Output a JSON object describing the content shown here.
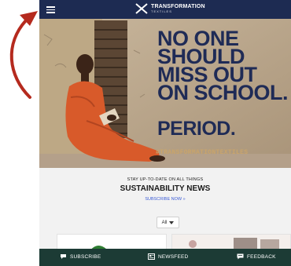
{
  "header": {
    "logo_title": "TRANSFORMATION",
    "logo_subtitle": "TEXTILES"
  },
  "hero": {
    "headline_lines": [
      "NO ONE",
      "SHOULD",
      "MISS OUT",
      "ON SCHOOL."
    ],
    "period": "PERIOD.",
    "hashtag": "#TRANSFORMATIONTEXTILES"
  },
  "news": {
    "kicker": "STAY UP-TO-DATE ON ALL THINGS",
    "title": "SUSTAINABILITY NEWS",
    "cta": "SUBSCRIBE NOW »"
  },
  "filter": {
    "selected": "All"
  },
  "bottom_bar": {
    "subscribe": "SUBSCRIBE",
    "newsfeed": "NEWSFEED",
    "feedback": "FEEDBACK"
  },
  "colors": {
    "header_bg": "#1d2b52",
    "headline": "#1f2b56",
    "bottom_bar_bg": "#1c3b35",
    "arrow": "#b52a1e",
    "link": "#3b5bd6"
  },
  "icons": [
    "menu-icon",
    "logo-icon",
    "chevron-down-icon",
    "chat-icon",
    "newspaper-icon",
    "comment-icon"
  ]
}
